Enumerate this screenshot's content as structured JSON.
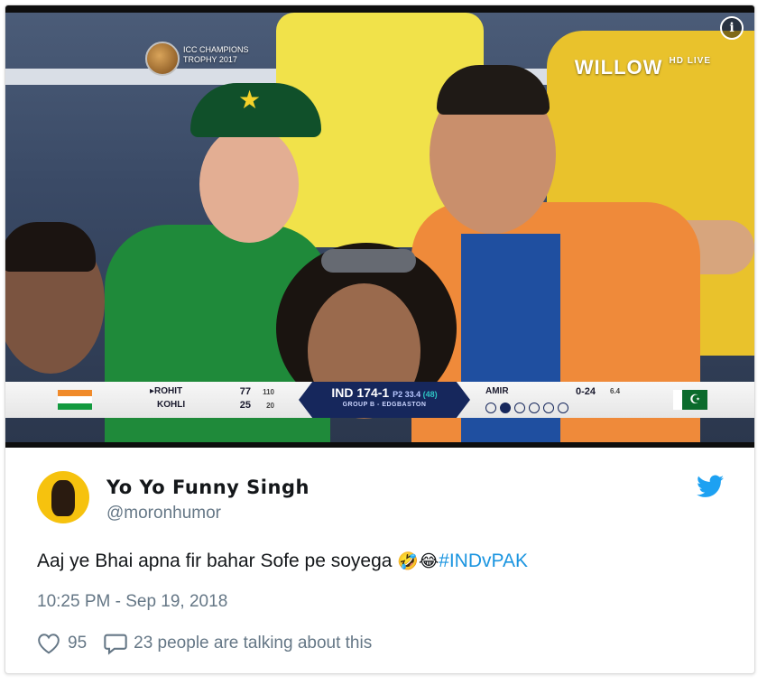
{
  "media": {
    "broadcast_logo": "WILLOW",
    "broadcast_logo_suffix": "HD LIVE",
    "event_logo_text": "ICC CHAMPIONS TROPHY 2017",
    "info_icon": "info-icon"
  },
  "scoreboard": {
    "batting_team_flag": "india-flag",
    "batsmen": [
      {
        "name": "▸ROHIT",
        "runs": "77",
        "balls": "110"
      },
      {
        "name": "KOHLI",
        "runs": "25",
        "balls": "20"
      }
    ],
    "team": "IND",
    "score": "174-1",
    "overs": "P2 33.4",
    "run_rate": "(48)",
    "match_info": "GROUP B - EDGBASTON",
    "bowler": "AMIR",
    "bowler_figures": "0-24",
    "bowler_overs": "6.4",
    "bowling_team_flag": "pakistan-flag"
  },
  "tweet": {
    "display_name": "Yo Yo Funny Singh",
    "handle": "@moronhumor",
    "text": "Aaj ye Bhai apna fir bahar Sofe pe soyega ",
    "emoji_1": "🤣",
    "emoji_2": "😂",
    "hashtag": "#INDvPAK",
    "timestamp": "10:25 PM - Sep 19, 2018",
    "likes": "95",
    "conversation": "23 people are talking about this",
    "brand_color": "#1da1f2",
    "link_color": "#1b95e0"
  }
}
